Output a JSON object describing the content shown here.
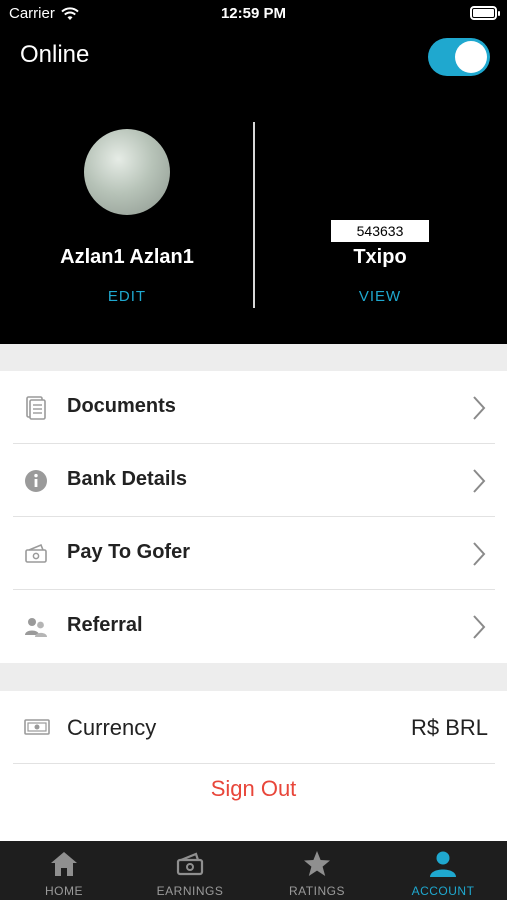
{
  "status_bar": {
    "carrier": "Carrier",
    "time": "12:59 PM"
  },
  "header": {
    "online_label": "Online",
    "online_toggle_on": true
  },
  "profile": {
    "name": "Azlan1 Azlan1",
    "edit_label": "EDIT"
  },
  "vehicle": {
    "plate": "543633",
    "name": "Txipo",
    "view_label": "VIEW"
  },
  "menu": {
    "items": [
      {
        "label": "Documents",
        "icon": "document-icon"
      },
      {
        "label": "Bank Details",
        "icon": "info-icon"
      },
      {
        "label": "Pay To Gofer",
        "icon": "cash-icon"
      },
      {
        "label": "Referral",
        "icon": "people-icon"
      }
    ]
  },
  "currency": {
    "label": "Currency",
    "value": "R$ BRL",
    "icon": "banknote-icon"
  },
  "signout": {
    "label": "Sign Out"
  },
  "tabbar": {
    "tabs": [
      {
        "label": "HOME",
        "icon": "home-icon"
      },
      {
        "label": "EARNINGS",
        "icon": "earnings-icon"
      },
      {
        "label": "RATINGS",
        "icon": "star-icon"
      },
      {
        "label": "ACCOUNT",
        "icon": "person-icon"
      }
    ],
    "active_tab": "ACCOUNT"
  },
  "colors": {
    "accent": "#1fa8cf",
    "signout": "#e8463a",
    "header_bg": "#000000",
    "tabbar_bg": "#1e1e1e"
  }
}
